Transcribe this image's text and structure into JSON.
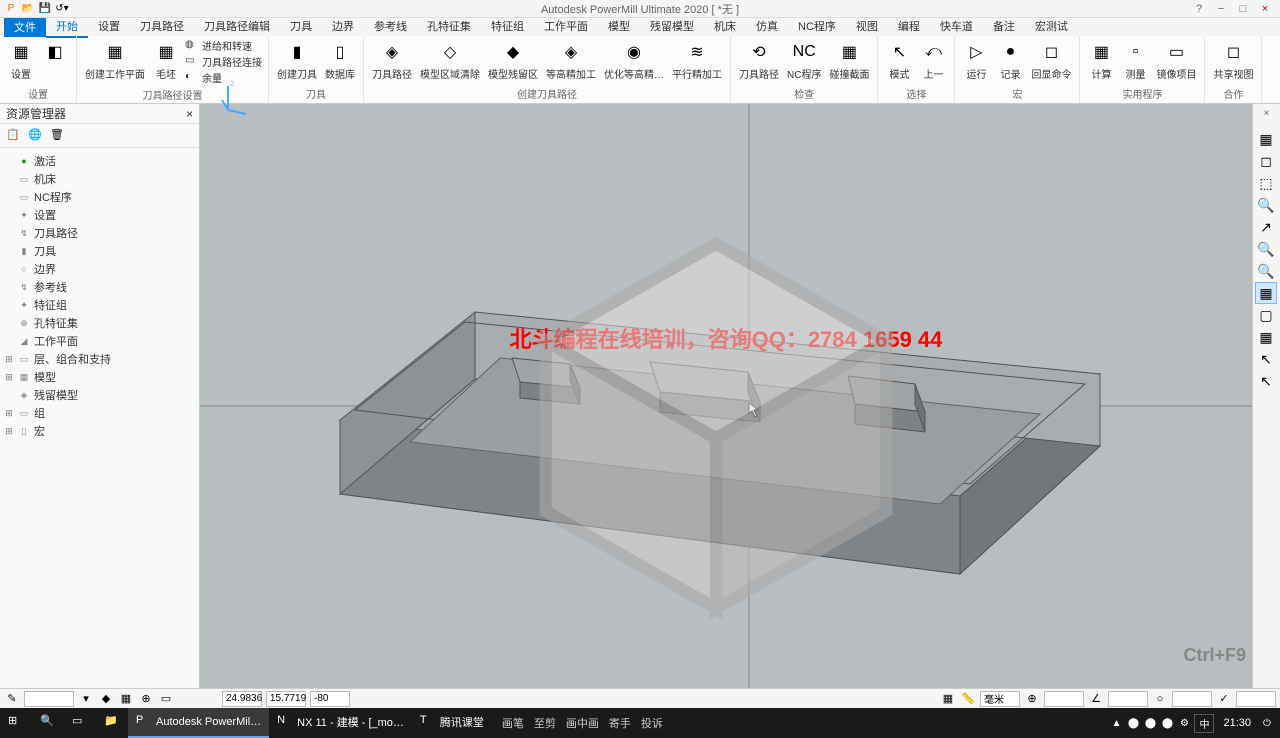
{
  "titlebar": {
    "app_title": "Autodesk PowerMill Ultimate 2020    [ *无 ]",
    "help": "?",
    "minimize": "−",
    "maximize": "□",
    "close": "×"
  },
  "menu": {
    "file": "文件",
    "tabs": [
      "开始",
      "设置",
      "刀具路径",
      "刀具路径编辑",
      "刀具",
      "边界",
      "参考线",
      "孔特征集",
      "特征组",
      "工作平面",
      "模型",
      "残留模型",
      "机床",
      "仿真",
      "NC程序",
      "视图",
      "编程",
      "快车道",
      "备注",
      "宏测试"
    ],
    "active_index": 0
  },
  "ribbon": {
    "groups": [
      {
        "label": "设置",
        "items": [
          {
            "icon": "▦",
            "label": "设置"
          },
          {
            "icon": "◧",
            "label": ""
          }
        ]
      },
      {
        "label": "刀具路径设置",
        "items": [
          {
            "icon": "▦",
            "label": "创建工作平面"
          },
          {
            "icon": "▦",
            "label": "毛坯"
          }
        ],
        "small": [
          {
            "icon": "◍",
            "text": "进给和转速"
          },
          {
            "icon": "▭",
            "text": "刀具路径连接"
          },
          {
            "icon": "◐",
            "text": "余量"
          }
        ]
      },
      {
        "label": "刀具",
        "items": [
          {
            "icon": "▮",
            "label": "创建刀具"
          },
          {
            "icon": "▯",
            "label": "数据库"
          }
        ]
      },
      {
        "label": "创建刀具路径",
        "items": [
          {
            "icon": "◈",
            "label": "刀具路径"
          },
          {
            "icon": "◇",
            "label": "模型区域清除"
          },
          {
            "icon": "◆",
            "label": "模型残留区"
          },
          {
            "icon": "◈",
            "label": "等高精加工"
          },
          {
            "icon": "◉",
            "label": "优化等高精…"
          },
          {
            "icon": "≋",
            "label": "平行精加工"
          }
        ]
      },
      {
        "label": "检查",
        "items": [
          {
            "icon": "⟲",
            "label": "刀具路径"
          },
          {
            "icon": "NC",
            "label": "NC程序"
          },
          {
            "icon": "▦",
            "label": "碰撞截面"
          }
        ]
      },
      {
        "label": "选择",
        "items": [
          {
            "icon": "↖",
            "label": "模式"
          },
          {
            "icon": "⤺",
            "label": "上一"
          }
        ]
      },
      {
        "label": "宏",
        "items": [
          {
            "icon": "▷",
            "label": "运行"
          },
          {
            "icon": "●",
            "label": "记录"
          },
          {
            "icon": "◻",
            "label": "回显命令"
          }
        ],
        "expand": "⌄"
      },
      {
        "label": "实用程序",
        "items": [
          {
            "icon": "▦",
            "label": "计算"
          },
          {
            "icon": "▫",
            "label": "测量"
          },
          {
            "icon": "▭",
            "label": "镜像项目"
          }
        ]
      },
      {
        "label": "合作",
        "items": [
          {
            "icon": "◻",
            "label": "共享视图"
          }
        ]
      }
    ]
  },
  "explorer": {
    "title": "资源管理器",
    "close": "×",
    "toolbar": [
      "list-icon",
      "globe-icon",
      "trash-icon"
    ],
    "tree": [
      {
        "exp": "",
        "icon": "●",
        "label": "激活",
        "color": "#0a0"
      },
      {
        "exp": "",
        "icon": "▭",
        "label": "机床"
      },
      {
        "exp": "",
        "icon": "▭",
        "label": "NC程序"
      },
      {
        "exp": "",
        "icon": "✦",
        "label": "设置"
      },
      {
        "exp": "",
        "icon": "↯",
        "label": "刀具路径"
      },
      {
        "exp": "",
        "icon": "▮",
        "label": "刀具"
      },
      {
        "exp": "",
        "icon": "○",
        "label": "边界"
      },
      {
        "exp": "",
        "icon": "↯",
        "label": "参考线"
      },
      {
        "exp": "",
        "icon": "✦",
        "label": "特征组"
      },
      {
        "exp": "",
        "icon": "⊕",
        "label": "孔特征集"
      },
      {
        "exp": "",
        "icon": "◢",
        "label": "工作平面"
      },
      {
        "exp": "⊞",
        "icon": "▭",
        "label": "层、组合和支持"
      },
      {
        "exp": "⊞",
        "icon": "▦",
        "label": "模型"
      },
      {
        "exp": "",
        "icon": "◈",
        "label": "残留模型"
      },
      {
        "exp": "⊞",
        "icon": "▭",
        "label": "组"
      },
      {
        "exp": "⊞",
        "icon": "▯",
        "label": "宏"
      }
    ]
  },
  "viewport": {
    "overlay": "北斗编程在线培训，咨询QQ：2784 1659 44",
    "triad_z": "z",
    "hint": "Ctrl+F9"
  },
  "right_toolbar": {
    "close": "×",
    "items": [
      {
        "name": "wireframe-icon",
        "sym": "▦"
      },
      {
        "name": "iso-icon",
        "sym": "◻"
      },
      {
        "name": "cube-icon",
        "sym": "⬚"
      },
      {
        "name": "zoom-icon",
        "sym": "🔍"
      },
      {
        "name": "arrow-icon",
        "sym": "↗"
      },
      {
        "name": "zoom-extend-icon",
        "sym": "🔍"
      },
      {
        "name": "zoom-window-icon",
        "sym": "🔍"
      },
      {
        "name": "shade-icon",
        "sym": "▦",
        "active": true
      },
      {
        "name": "box-icon",
        "sym": "▢"
      },
      {
        "name": "box2-icon",
        "sym": "▦"
      },
      {
        "name": "cursor-arrow-icon",
        "sym": "↖"
      },
      {
        "name": "cursor-icon",
        "sym": "↖"
      }
    ]
  },
  "statusbar": {
    "coords": [
      "24.9836",
      "15.7719",
      "-80"
    ],
    "unit": "毫米"
  },
  "taskbar": {
    "apps": [
      {
        "icon": "⊞",
        "label": "",
        "name": "start"
      },
      {
        "icon": "🔍",
        "label": "",
        "name": "search"
      },
      {
        "icon": "▭",
        "label": "",
        "name": "taskview"
      },
      {
        "icon": "📁",
        "label": "",
        "name": "explorer"
      },
      {
        "icon": "P",
        "label": "Autodesk PowerMil…",
        "name": "powermill",
        "active": true
      },
      {
        "icon": "N",
        "label": "NX 11 - 建模 - [_mo…",
        "name": "nx"
      },
      {
        "icon": "T",
        "label": "腾讯课堂",
        "name": "tencent"
      }
    ],
    "ime": [
      "画笔",
      "至剪",
      "画中画",
      "寄手",
      "投诉"
    ],
    "tray_icons": [
      "▲",
      "⬤",
      "⬤",
      "⬤",
      "⚙"
    ],
    "lang": "中",
    "clock": "21:30",
    "power": "⏻"
  }
}
